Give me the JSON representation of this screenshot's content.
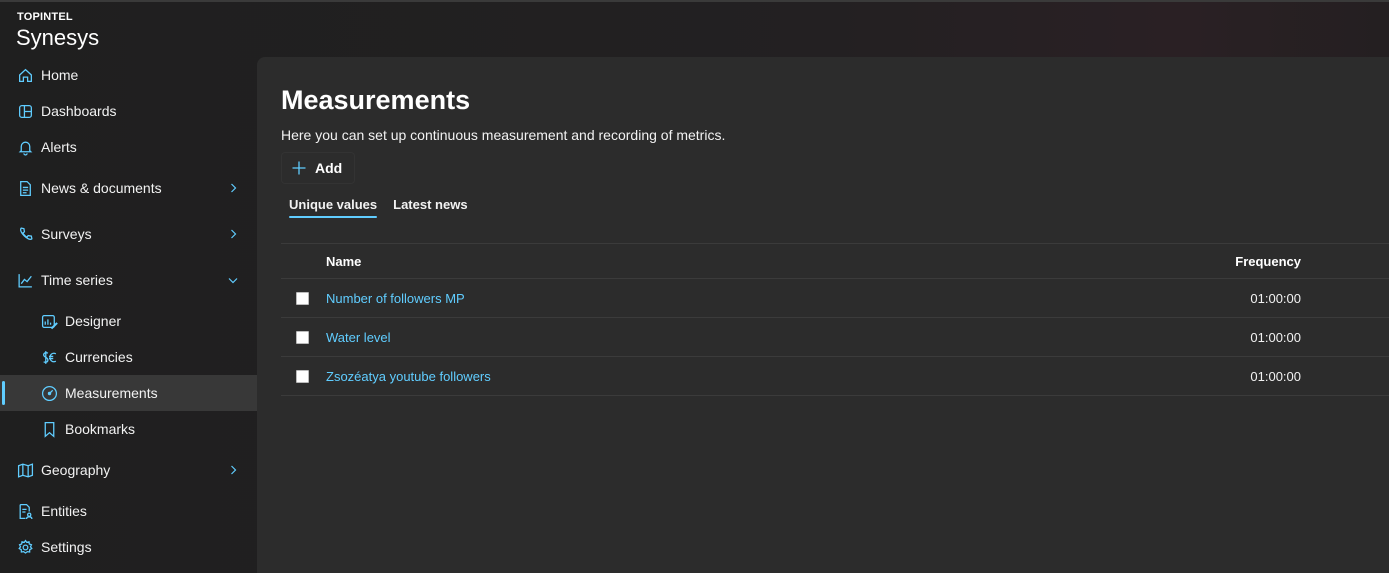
{
  "app": {
    "org": "TOPINTEL",
    "name": "Synesys"
  },
  "colors": {
    "accent": "#60cdff",
    "background": "#1f1f1f",
    "panel": "#2c2c2c"
  },
  "sidebar": {
    "items": [
      {
        "label": "Home",
        "icon": "home-icon"
      },
      {
        "label": "Dashboards",
        "icon": "dashboard-icon"
      },
      {
        "label": "Alerts",
        "icon": "bell-icon"
      },
      {
        "label": "News & documents",
        "icon": "document-icon",
        "expandable": true
      },
      {
        "label": "Surveys",
        "icon": "phone-icon",
        "expandable": true
      },
      {
        "label": "Time series",
        "icon": "chart-line-icon",
        "expanded": true
      },
      {
        "label": "Designer",
        "icon": "designer-icon",
        "sub": true
      },
      {
        "label": "Currencies",
        "icon": "currency-icon",
        "sub": true
      },
      {
        "label": "Measurements",
        "icon": "gauge-icon",
        "sub": true,
        "active": true
      },
      {
        "label": "Bookmarks",
        "icon": "bookmark-icon",
        "sub": true
      },
      {
        "label": "Geography",
        "icon": "map-icon",
        "expandable": true
      },
      {
        "label": "Entities",
        "icon": "entity-icon"
      },
      {
        "label": "Settings",
        "icon": "gear-icon"
      }
    ]
  },
  "main": {
    "title": "Measurements",
    "description": "Here you can set up continuous measurement and recording of metrics.",
    "add_label": "Add",
    "tabs": [
      {
        "label": "Unique values",
        "active": true
      },
      {
        "label": "Latest news",
        "active": false
      }
    ],
    "table": {
      "columns": {
        "name": "Name",
        "frequency": "Frequency"
      },
      "rows": [
        {
          "name": "Number of followers MP",
          "frequency": "01:00:00"
        },
        {
          "name": "Water level",
          "frequency": "01:00:00"
        },
        {
          "name": "Zsozéatya youtube followers",
          "frequency": "01:00:00"
        }
      ]
    }
  }
}
